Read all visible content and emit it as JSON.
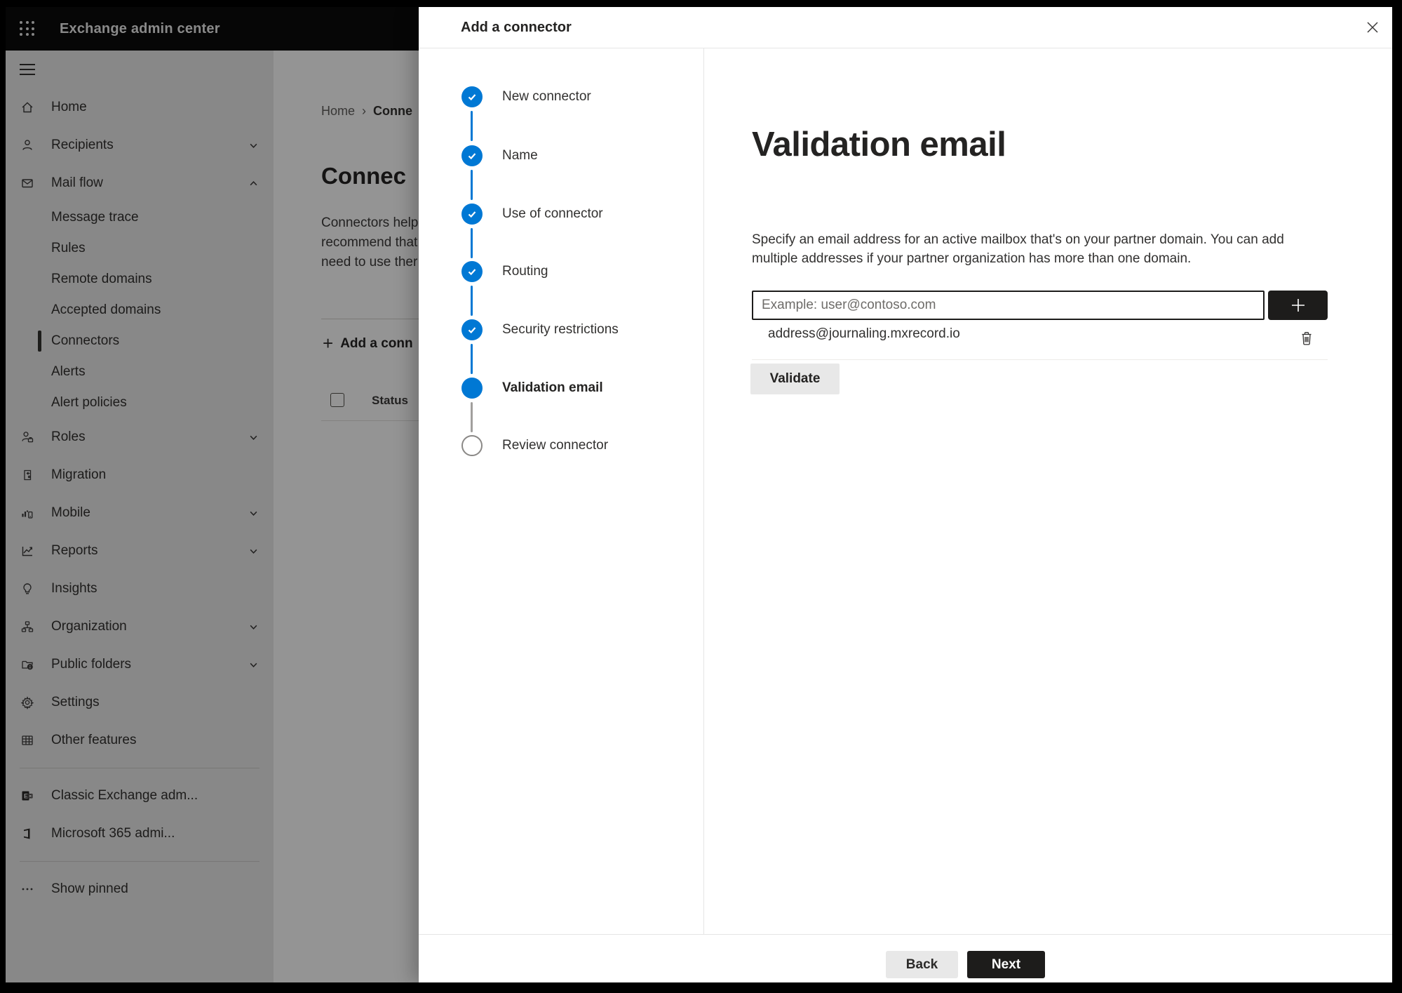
{
  "topbar": {
    "title": "Exchange admin center"
  },
  "sidebar": {
    "items": [
      {
        "label": "Home"
      },
      {
        "label": "Recipients"
      },
      {
        "label": "Mail flow"
      },
      {
        "label": "Message trace"
      },
      {
        "label": "Rules"
      },
      {
        "label": "Remote domains"
      },
      {
        "label": "Accepted domains"
      },
      {
        "label": "Connectors",
        "selected": true
      },
      {
        "label": "Alerts"
      },
      {
        "label": "Alert policies"
      },
      {
        "label": "Roles"
      },
      {
        "label": "Migration"
      },
      {
        "label": "Mobile"
      },
      {
        "label": "Reports"
      },
      {
        "label": "Insights"
      },
      {
        "label": "Organization"
      },
      {
        "label": "Public folders"
      },
      {
        "label": "Settings"
      },
      {
        "label": "Other features"
      },
      {
        "label": "Classic Exchange adm..."
      },
      {
        "label": "Microsoft 365 admi..."
      },
      {
        "label": "Show pinned"
      }
    ]
  },
  "background": {
    "breadcrumb": {
      "home": "Home",
      "separator": "›",
      "current": "Conne"
    },
    "heading": "Connec",
    "paragraph_lines": [
      "Connectors help",
      "recommend that",
      "need to use ther"
    ],
    "add_connector_label": "Add a conn",
    "status_header": "Status"
  },
  "modal": {
    "title": "Add a connector",
    "steps": [
      {
        "label": "New connector",
        "state": "completed"
      },
      {
        "label": "Name",
        "state": "completed"
      },
      {
        "label": "Use of connector",
        "state": "completed"
      },
      {
        "label": "Routing",
        "state": "completed"
      },
      {
        "label": "Security restrictions",
        "state": "completed"
      },
      {
        "label": "Validation email",
        "state": "current"
      },
      {
        "label": "Review connector",
        "state": "upcoming"
      }
    ],
    "content": {
      "heading": "Validation email",
      "description": "Specify an email address for an active mailbox that's on your partner domain. You can add multiple addresses if your partner organization has more than one domain.",
      "input_placeholder": "Example: user@contoso.com",
      "input_value": "",
      "address": "address@journaling.mxrecord.io",
      "validate_label": "Validate"
    },
    "footer": {
      "back_label": "Back",
      "next_label": "Next"
    }
  },
  "colors": {
    "accent": "#0078d4",
    "dark_button": "#1d1c1b",
    "scrim": "rgba(0,0,0,0.42)"
  }
}
